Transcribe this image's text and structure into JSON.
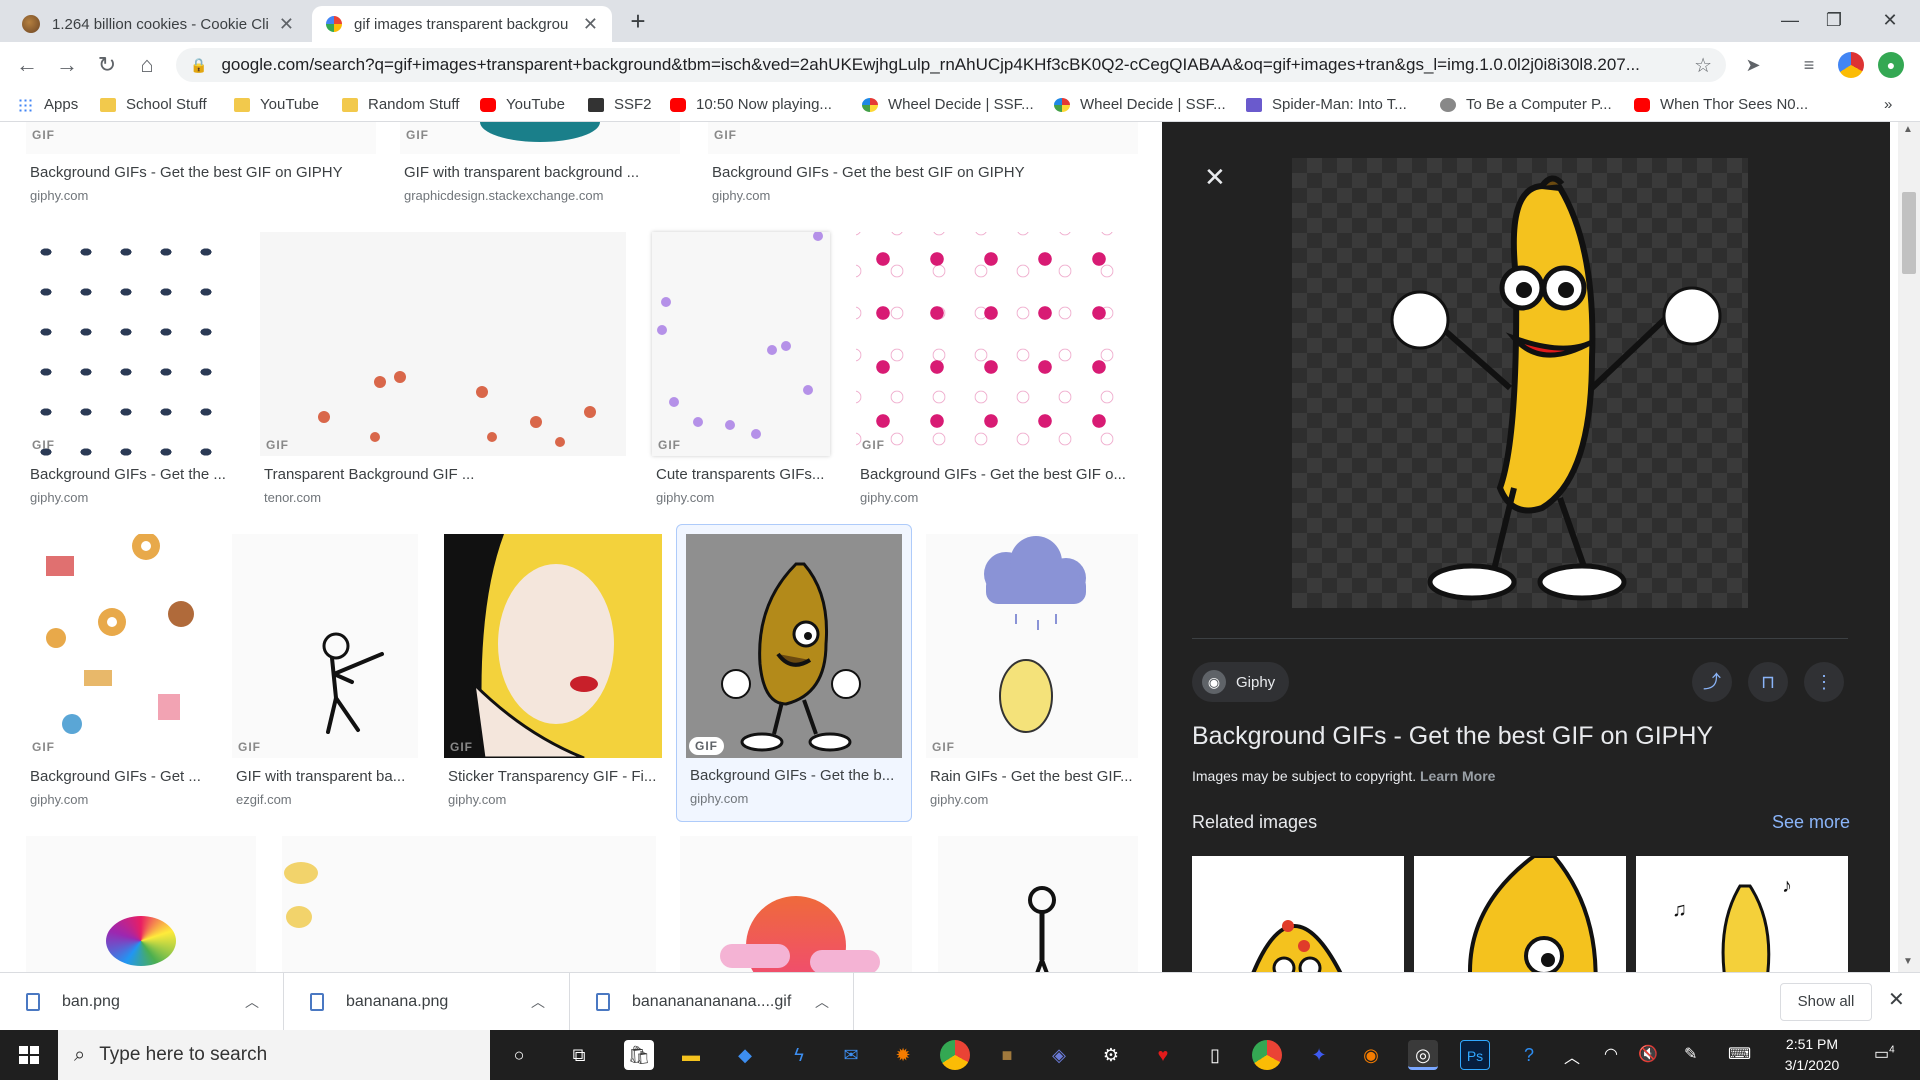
{
  "browser": {
    "tabs": [
      {
        "title": "1.264 billion cookies - Cookie Cli",
        "icon": "cookie-icon"
      },
      {
        "title": "gif images transparent backgrou",
        "icon": "google-icon"
      }
    ],
    "new_tab": "+",
    "address": "google.com/search?q=gif+images+transparent+background&tbm=isch&ved=2ahUKEwjhgLulp_rnAhUCjp4KHf3cBK0Q2-cCegQIABAA&oq=gif+images+tran&gs_l=img.1.0.0l2j0i8i30l8.207...",
    "bookmarks": [
      {
        "label": "Apps",
        "icon": "apps-grid-icon"
      },
      {
        "label": "School Stuff",
        "icon": "folder-icon"
      },
      {
        "label": "YouTube",
        "icon": "folder-icon"
      },
      {
        "label": "Random Stuff",
        "icon": "folder-icon"
      },
      {
        "label": "YouTube",
        "icon": "youtube-icon"
      },
      {
        "label": "SSF2",
        "icon": "ssf2-icon"
      },
      {
        "label": "10:50 Now playing...",
        "icon": "youtube-icon"
      },
      {
        "label": "Wheel Decide | SSF...",
        "icon": "wheel-icon"
      },
      {
        "label": "Wheel Decide | SSF...",
        "icon": "wheel-icon"
      },
      {
        "label": "Spider-Man: Into T...",
        "icon": "spiderman-icon"
      },
      {
        "label": "To Be a Computer P...",
        "icon": "computer-icon"
      },
      {
        "label": "When Thor Sees N0...",
        "icon": "youtube-icon"
      }
    ],
    "bookmarks_overflow": "»"
  },
  "results": {
    "row0": [
      {
        "title": "Background GIFs - Get the best GIF on GIPHY",
        "source": "giphy.com",
        "badge": "GIF"
      },
      {
        "title": "GIF with transparent background ...",
        "source": "graphicdesign.stackexchange.com",
        "badge": "GIF"
      },
      {
        "title": "Background GIFs - Get the best GIF on GIPHY",
        "source": "giphy.com",
        "badge": "GIF"
      }
    ],
    "row1": [
      {
        "title": "Background GIFs - Get the ...",
        "source": "giphy.com",
        "badge": "GIF"
      },
      {
        "title": "Transparent Background GIF ...",
        "source": "tenor.com",
        "badge": "GIF"
      },
      {
        "title": "Cute transparents GIFs...",
        "source": "giphy.com",
        "badge": "GIF"
      },
      {
        "title": "Background GIFs - Get the best GIF o...",
        "source": "giphy.com",
        "badge": "GIF"
      }
    ],
    "row2": [
      {
        "title": "Background GIFs - Get ...",
        "source": "giphy.com",
        "badge": "GIF"
      },
      {
        "title": "GIF with transparent ba...",
        "source": "ezgif.com",
        "badge": "GIF"
      },
      {
        "title": "Sticker Transparency GIF - Fi...",
        "source": "giphy.com",
        "badge": "GIF"
      },
      {
        "title": "Background GIFs - Get the b...",
        "source": "giphy.com",
        "badge": "GIF"
      },
      {
        "title": "Rain GIFs - Get the best GIF...",
        "source": "giphy.com",
        "badge": "GIF"
      }
    ]
  },
  "panel": {
    "close": "✕",
    "source": "Giphy",
    "title": "Background GIFs - Get the best GIF on GIPHY",
    "copyright": "Images may be subject to copyright.",
    "learn_more": "Learn More",
    "related": "Related images",
    "see_more": "See more"
  },
  "downloads": {
    "items": [
      "ban.png",
      "bananana.png",
      "banananananana....gif"
    ],
    "show_all": "Show all"
  },
  "taskbar": {
    "search_placeholder": "Type here to search",
    "time": "2:51 PM",
    "date": "3/1/2020",
    "notifications": "4"
  },
  "colors": {
    "panel_bg": "#222222",
    "accent": "#8ab4f8",
    "banana": "#f5c518"
  }
}
